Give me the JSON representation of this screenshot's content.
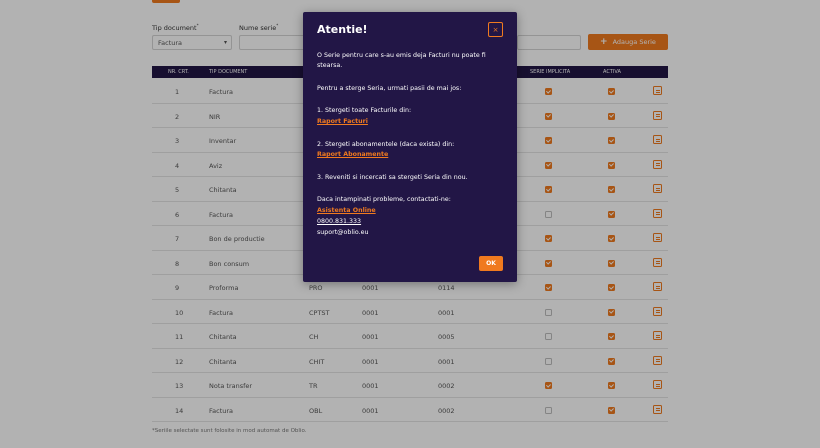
{
  "form": {
    "tip_document_label": "Tip document",
    "tip_document_value": "Factura",
    "nume_serie_label": "Nume serie",
    "add_button_label": "Adauga Serie"
  },
  "table": {
    "headers": [
      "NR. CRT.",
      "TIP DOCUMENT",
      "SERIE IMPLICITA",
      "ACTIVA"
    ],
    "rows": [
      {
        "nr": "1",
        "tip": "Factura",
        "serie": "",
        "nr_start": "",
        "nr_curent": "",
        "implicita": true,
        "activa": true
      },
      {
        "nr": "2",
        "tip": "NIR",
        "serie": "",
        "nr_start": "",
        "nr_curent": "",
        "implicita": true,
        "activa": true
      },
      {
        "nr": "3",
        "tip": "Inventar",
        "serie": "",
        "nr_start": "",
        "nr_curent": "",
        "implicita": true,
        "activa": true
      },
      {
        "nr": "4",
        "tip": "Aviz",
        "serie": "",
        "nr_start": "",
        "nr_curent": "",
        "implicita": true,
        "activa": true
      },
      {
        "nr": "5",
        "tip": "Chitanta",
        "serie": "",
        "nr_start": "",
        "nr_curent": "",
        "implicita": true,
        "activa": true
      },
      {
        "nr": "6",
        "tip": "Factura",
        "serie": "",
        "nr_start": "",
        "nr_curent": "",
        "implicita": false,
        "activa": true
      },
      {
        "nr": "7",
        "tip": "Bon de productie",
        "serie": "",
        "nr_start": "",
        "nr_curent": "",
        "implicita": true,
        "activa": true
      },
      {
        "nr": "8",
        "tip": "Bon consum",
        "serie": "",
        "nr_start": "",
        "nr_curent": "",
        "implicita": true,
        "activa": true
      },
      {
        "nr": "9",
        "tip": "Proforma",
        "serie": "PRO",
        "nr_start": "0001",
        "nr_curent": "0114",
        "implicita": true,
        "activa": true
      },
      {
        "nr": "10",
        "tip": "Factura",
        "serie": "CPTST",
        "nr_start": "0001",
        "nr_curent": "0001",
        "implicita": false,
        "activa": true
      },
      {
        "nr": "11",
        "tip": "Chitanta",
        "serie": "CH",
        "nr_start": "0001",
        "nr_curent": "0005",
        "implicita": false,
        "activa": true
      },
      {
        "nr": "12",
        "tip": "Chitanta",
        "serie": "CHIT",
        "nr_start": "0001",
        "nr_curent": "0001",
        "implicita": false,
        "activa": true
      },
      {
        "nr": "13",
        "tip": "Nota transfer",
        "serie": "TR",
        "nr_start": "0001",
        "nr_curent": "0002",
        "implicita": true,
        "activa": true
      },
      {
        "nr": "14",
        "tip": "Factura",
        "serie": "OBL",
        "nr_start": "0001",
        "nr_curent": "0002",
        "implicita": false,
        "activa": true
      }
    ]
  },
  "footnote": "*Seriile selectate sunt folosite in mod automat de Oblio.",
  "modal": {
    "title": "Atentie!",
    "close_label": "×",
    "p1": "O Serie pentru care s-au emis deja Facturi nu poate fi stearsa.",
    "p2": "Pentru a sterge Seria, urmati pasii de mai jos:",
    "step1": "1. Stergeti toate Facturile din:",
    "link1": "Raport Facturi",
    "step2": "2. Stergeti abonamentele (daca exista) din:",
    "link2": "Raport Abonamente",
    "step3": "3. Reveniti si incercati sa stergeti Seria din nou.",
    "contact": "Daca intampinati probleme, contactati-ne:",
    "link3": "Asistenta Online",
    "phone": "0800.831.333",
    "email": "suport@oblio.eu",
    "ok_label": "OK"
  },
  "colors": {
    "accent": "#f07a1f",
    "header_bg": "#221646",
    "modal_bg": "#221646"
  }
}
